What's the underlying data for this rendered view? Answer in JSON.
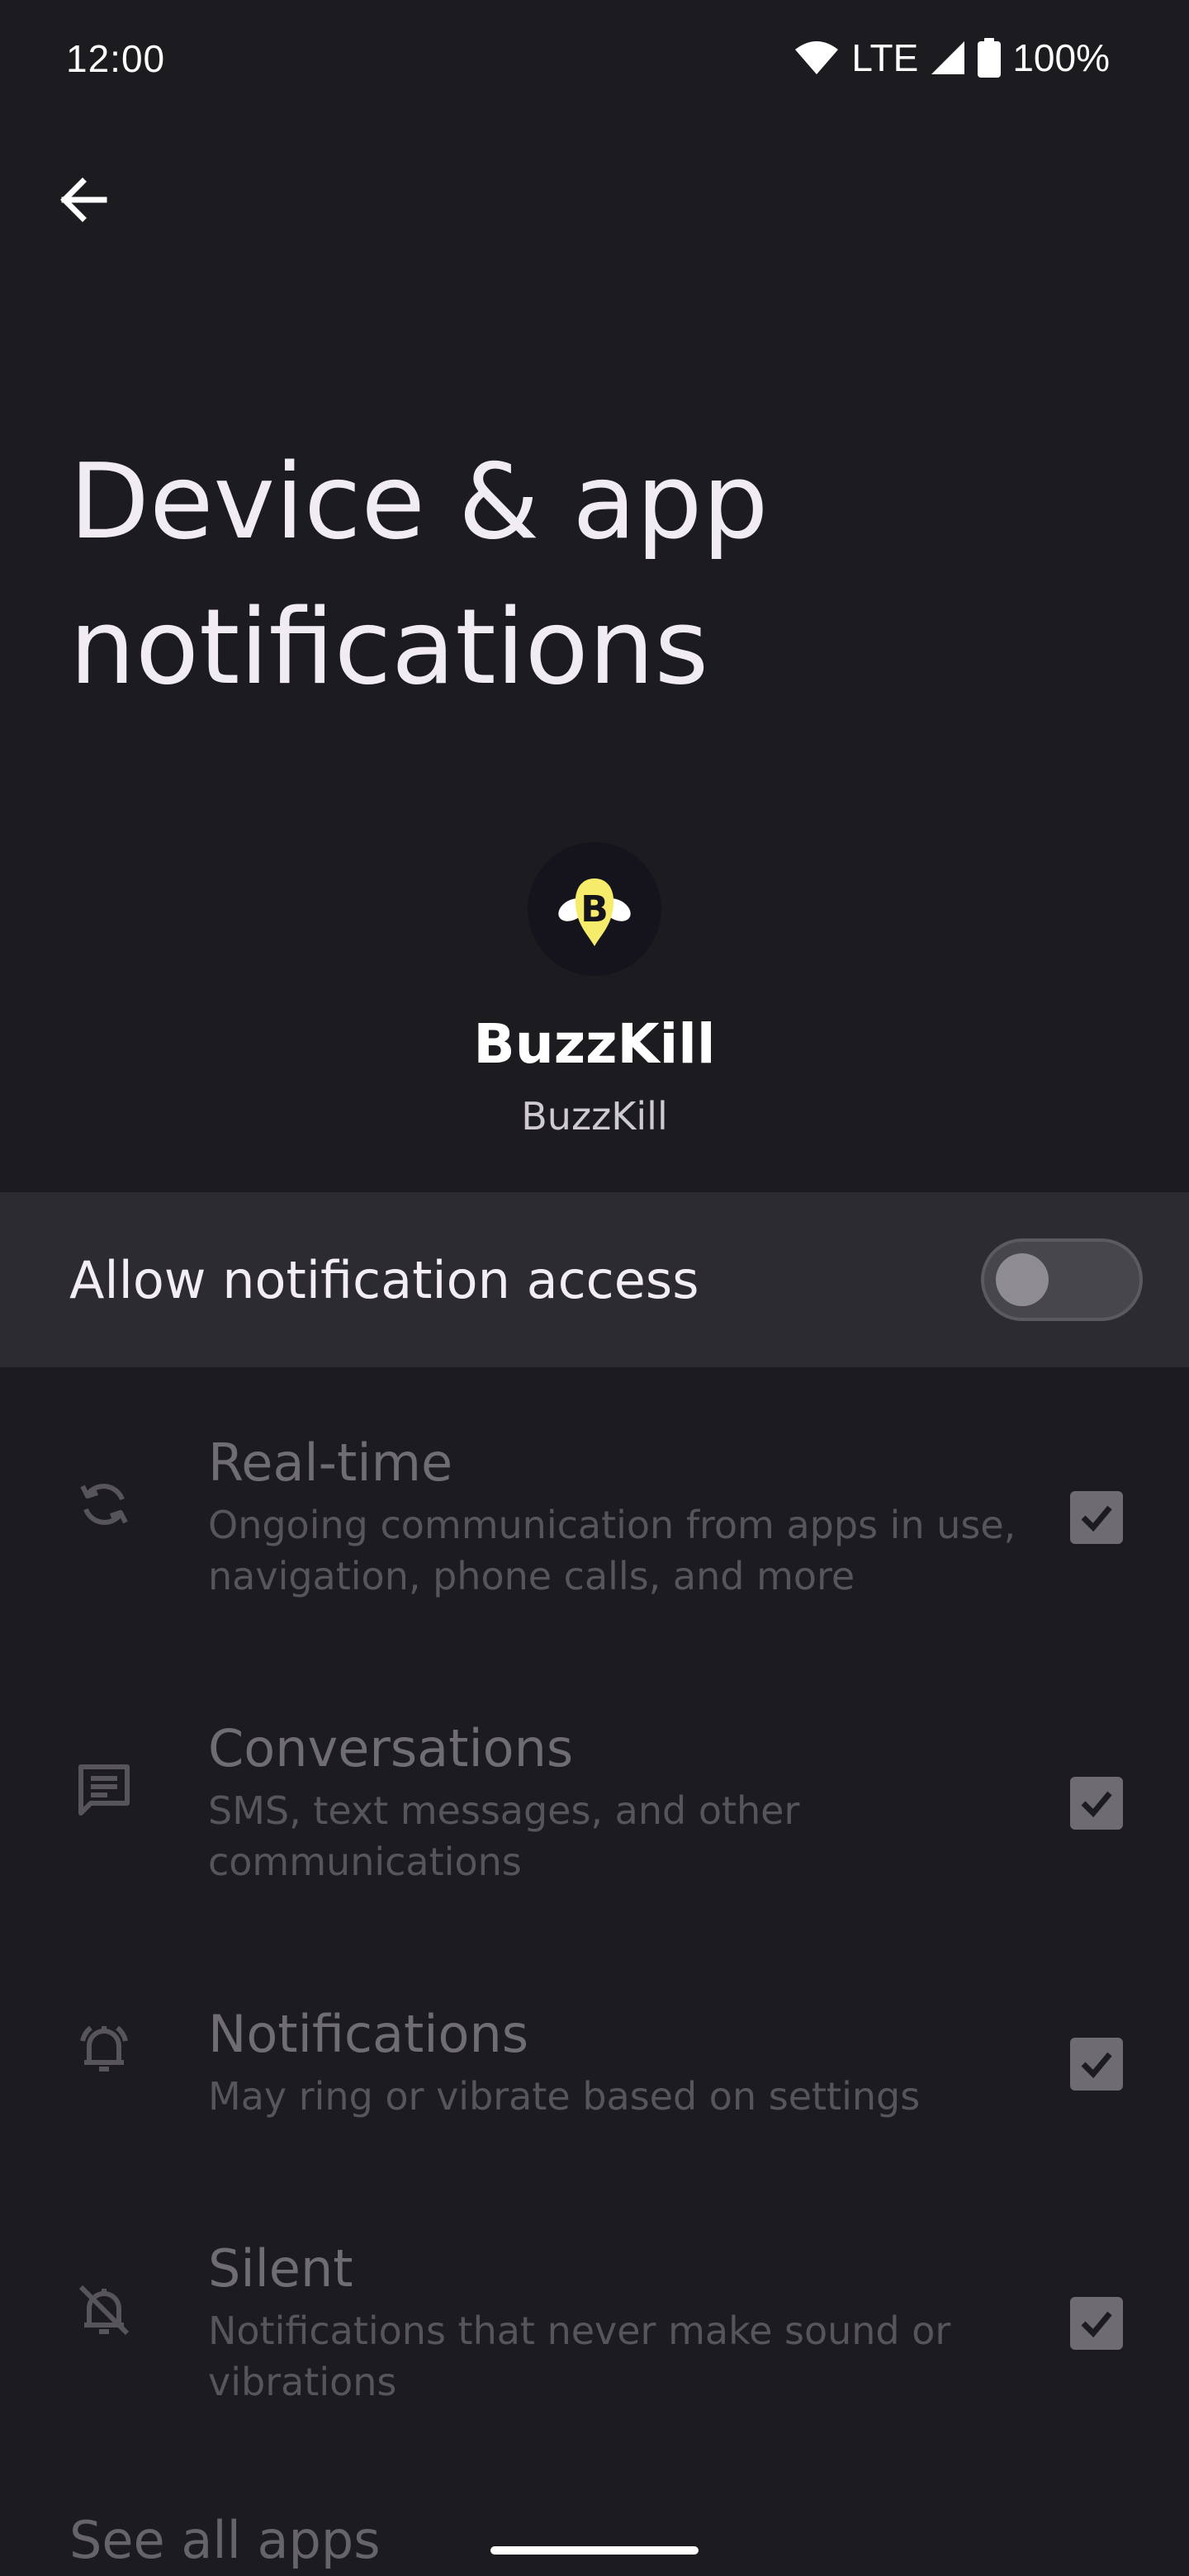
{
  "status_bar": {
    "time": "12:00",
    "network": "LTE",
    "battery": "100%",
    "icons": [
      "wifi-icon",
      "cell-signal-icon",
      "battery-icon"
    ]
  },
  "header": {
    "back_icon": "arrow-back-icon",
    "title": "Device & app notifications"
  },
  "app": {
    "name": "BuzzKill",
    "package": "BuzzKill",
    "icon": "buzzkill-bee-icon"
  },
  "access": {
    "label": "Allow notification access",
    "enabled": false
  },
  "notification_types": [
    {
      "title": "Real-time",
      "description": "Ongoing communication from apps in use, navigation, phone calls, and more",
      "icon": "sync-icon",
      "checked": true
    },
    {
      "title": "Conversations",
      "description": "SMS, text messages, and other communications",
      "icon": "message-icon",
      "checked": true
    },
    {
      "title": "Notifications",
      "description": "May ring or vibrate based on settings",
      "icon": "bell-ring-icon",
      "checked": true
    },
    {
      "title": "Silent",
      "description": "Notifications that never make sound or vibrations",
      "icon": "bell-off-icon",
      "checked": true
    }
  ],
  "footer": {
    "see_all": "See all apps"
  },
  "colors": {
    "background": "#1c1b20",
    "toggle_row": "#2c2b30",
    "app_icon_yellow": "#f6eb6a"
  }
}
